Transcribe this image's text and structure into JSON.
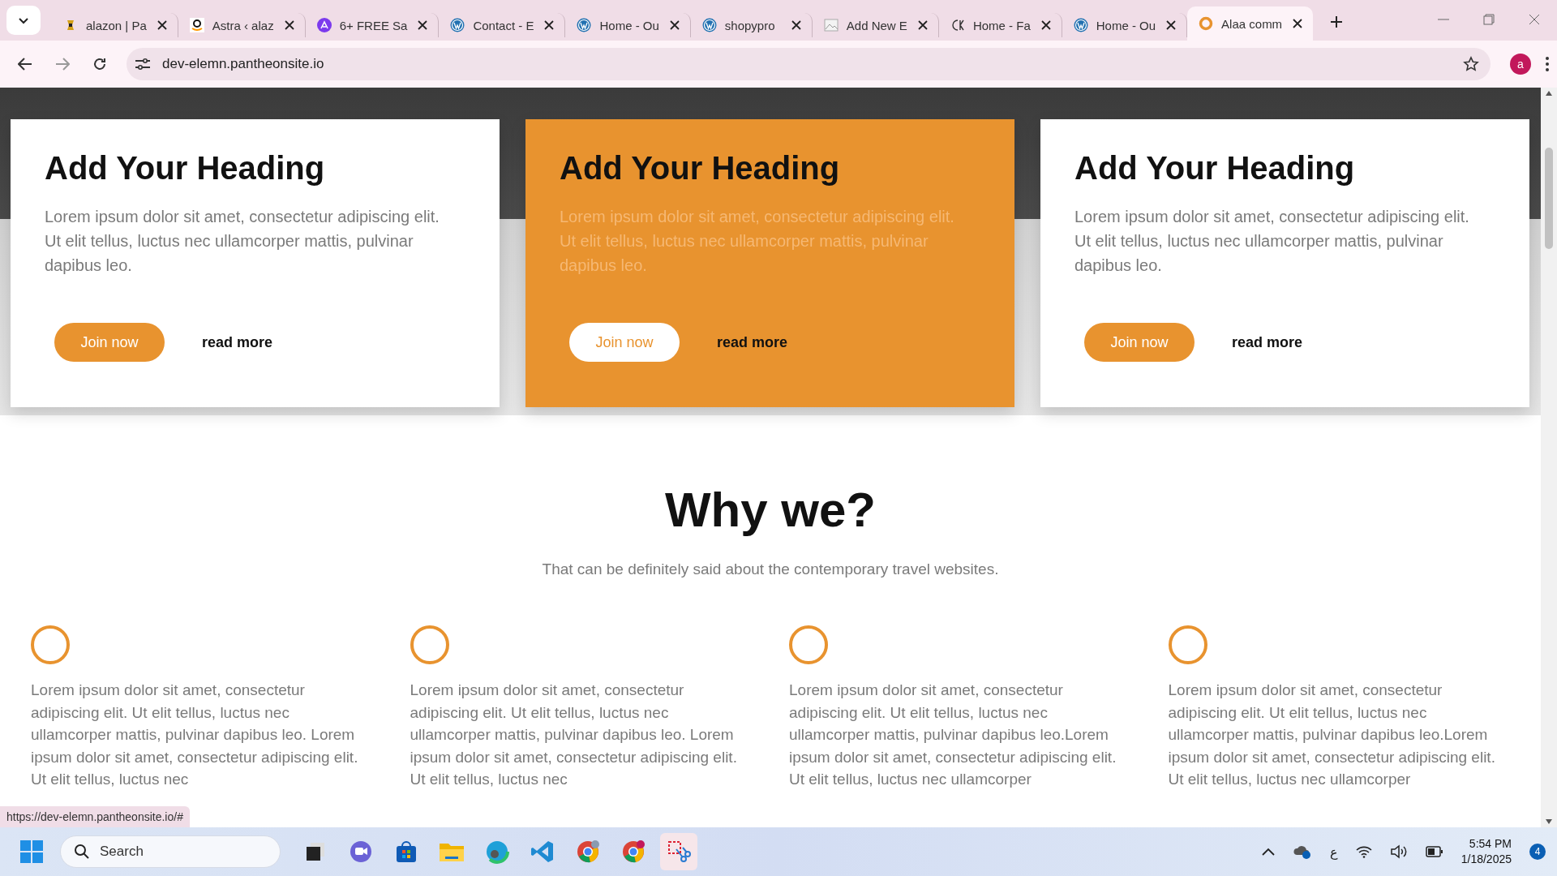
{
  "browser": {
    "tabs": [
      {
        "title": "alazon | Pa",
        "kind": "generic",
        "selected": false
      },
      {
        "title": "Astra ‹ alaz",
        "kind": "amazon",
        "selected": false
      },
      {
        "title": "6+ FREE Sa",
        "kind": "astra",
        "selected": false
      },
      {
        "title": "Contact - E",
        "kind": "wordpress",
        "selected": false
      },
      {
        "title": "Home - Ou",
        "kind": "wordpress",
        "selected": false
      },
      {
        "title": "shopypro",
        "kind": "wordpress",
        "selected": false
      },
      {
        "title": "Add New E",
        "kind": "image",
        "selected": false
      },
      {
        "title": "Home - Fa",
        "kind": "ck",
        "selected": false
      },
      {
        "title": "Home - Ou",
        "kind": "wordpress",
        "selected": false
      },
      {
        "title": "Alaa comm",
        "kind": "ring",
        "selected": true
      }
    ],
    "address": "dev-elemn.pantheonsite.io",
    "profile": "a"
  },
  "cards": [
    {
      "heading": "Add Your Heading",
      "text": "Lorem ipsum dolor sit amet, consectetur adipiscing elit. Ut elit tellus, luctus nec ullamcorper mattis, pulvinar dapibus leo.",
      "primary_button": "Join now",
      "secondary_button": "read more",
      "highlighted": false
    },
    {
      "heading": "Add Your Heading",
      "text": "Lorem ipsum dolor sit amet, consectetur adipiscing elit. Ut elit tellus, luctus nec ullamcorper mattis, pulvinar dapibus leo.",
      "primary_button": "Join now",
      "secondary_button": "read more",
      "highlighted": true
    },
    {
      "heading": "Add Your Heading",
      "text": "Lorem ipsum dolor sit amet, consectetur adipiscing elit. Ut elit tellus, luctus nec ullamcorper mattis, pulvinar dapibus leo.",
      "primary_button": "Join now",
      "secondary_button": "read more",
      "highlighted": false
    }
  ],
  "why": {
    "heading": "Why we?",
    "subtitle": "That can be definitely said about the contemporary travel websites.",
    "features": [
      {
        "text": "Lorem ipsum dolor sit amet, consectetur adipiscing elit. Ut elit tellus, luctus nec ullamcorper mattis, pulvinar dapibus leo. Lorem ipsum dolor sit amet, consectetur adipiscing elit. Ut elit tellus, luctus nec"
      },
      {
        "text": "Lorem ipsum dolor sit amet, consectetur adipiscing elit. Ut elit tellus, luctus nec ullamcorper mattis, pulvinar dapibus leo. Lorem ipsum dolor sit amet, consectetur adipiscing elit. Ut elit tellus, luctus nec"
      },
      {
        "text": "Lorem ipsum dolor sit amet, consectetur adipiscing elit. Ut elit tellus, luctus nec ullamcorper mattis, pulvinar dapibus leo.Lorem ipsum dolor sit amet, consectetur adipiscing elit. Ut elit tellus, luctus nec ullamcorper"
      },
      {
        "text": "Lorem ipsum dolor sit amet, consectetur adipiscing elit. Ut elit tellus, luctus nec ullamcorper mattis, pulvinar dapibus leo.Lorem ipsum dolor sit amet, consectetur adipiscing elit. Ut elit tellus, luctus nec ullamcorper"
      }
    ]
  },
  "status_url": "https://dev-elemn.pantheonsite.io/#",
  "taskbar": {
    "search": "Search",
    "language": "ع",
    "time": "5:54 PM",
    "date": "1/18/2025",
    "notifications": "4"
  }
}
